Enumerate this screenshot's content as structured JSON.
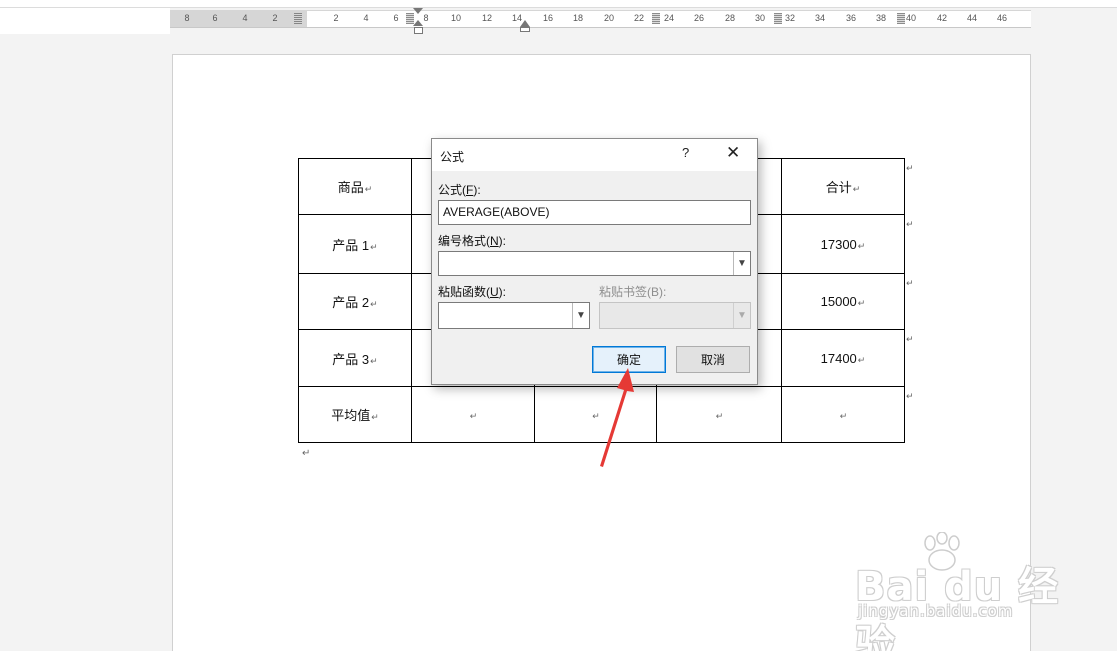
{
  "ruler": {
    "ticks": [
      "8",
      "6",
      "4",
      "2",
      "2",
      "4",
      "6",
      "8",
      "10",
      "12",
      "14",
      "16",
      "18",
      "20",
      "22",
      "24",
      "26",
      "28",
      "30",
      "32",
      "34",
      "36",
      "38",
      "40",
      "42",
      "44",
      "46"
    ]
  },
  "table": {
    "header": [
      "商品",
      "",
      "",
      "",
      "合计"
    ],
    "rows": [
      [
        "产品 1",
        "",
        "",
        "",
        "17300"
      ],
      [
        "产品 2",
        "",
        "",
        "",
        "15000"
      ],
      [
        "产品 3",
        "",
        "",
        "",
        "17400"
      ],
      [
        "平均值",
        "",
        "",
        "",
        ""
      ]
    ],
    "mark": "↵"
  },
  "dialog": {
    "title": "公式",
    "help": "?",
    "close": "✕",
    "formula_label": "公式(",
    "formula_key": "F",
    "formula_label_end": "):",
    "formula_value": "AVERAGE(ABOVE)",
    "numfmt_label": "编号格式(",
    "numfmt_key": "N",
    "numfmt_label_end": "):",
    "numfmt_value": "",
    "paste_func_label": "粘贴函数(",
    "paste_func_key": "U",
    "paste_func_label_end": "):",
    "paste_bookmark_label": "粘贴书签(B):",
    "ok_label": "确定",
    "cancel_label": "取消"
  },
  "watermark": {
    "logo": "Bai du 经验",
    "url": "jingyan.baidu.com"
  },
  "colors": {
    "ok_border": "#0078d7",
    "arrow": "#e53935"
  }
}
